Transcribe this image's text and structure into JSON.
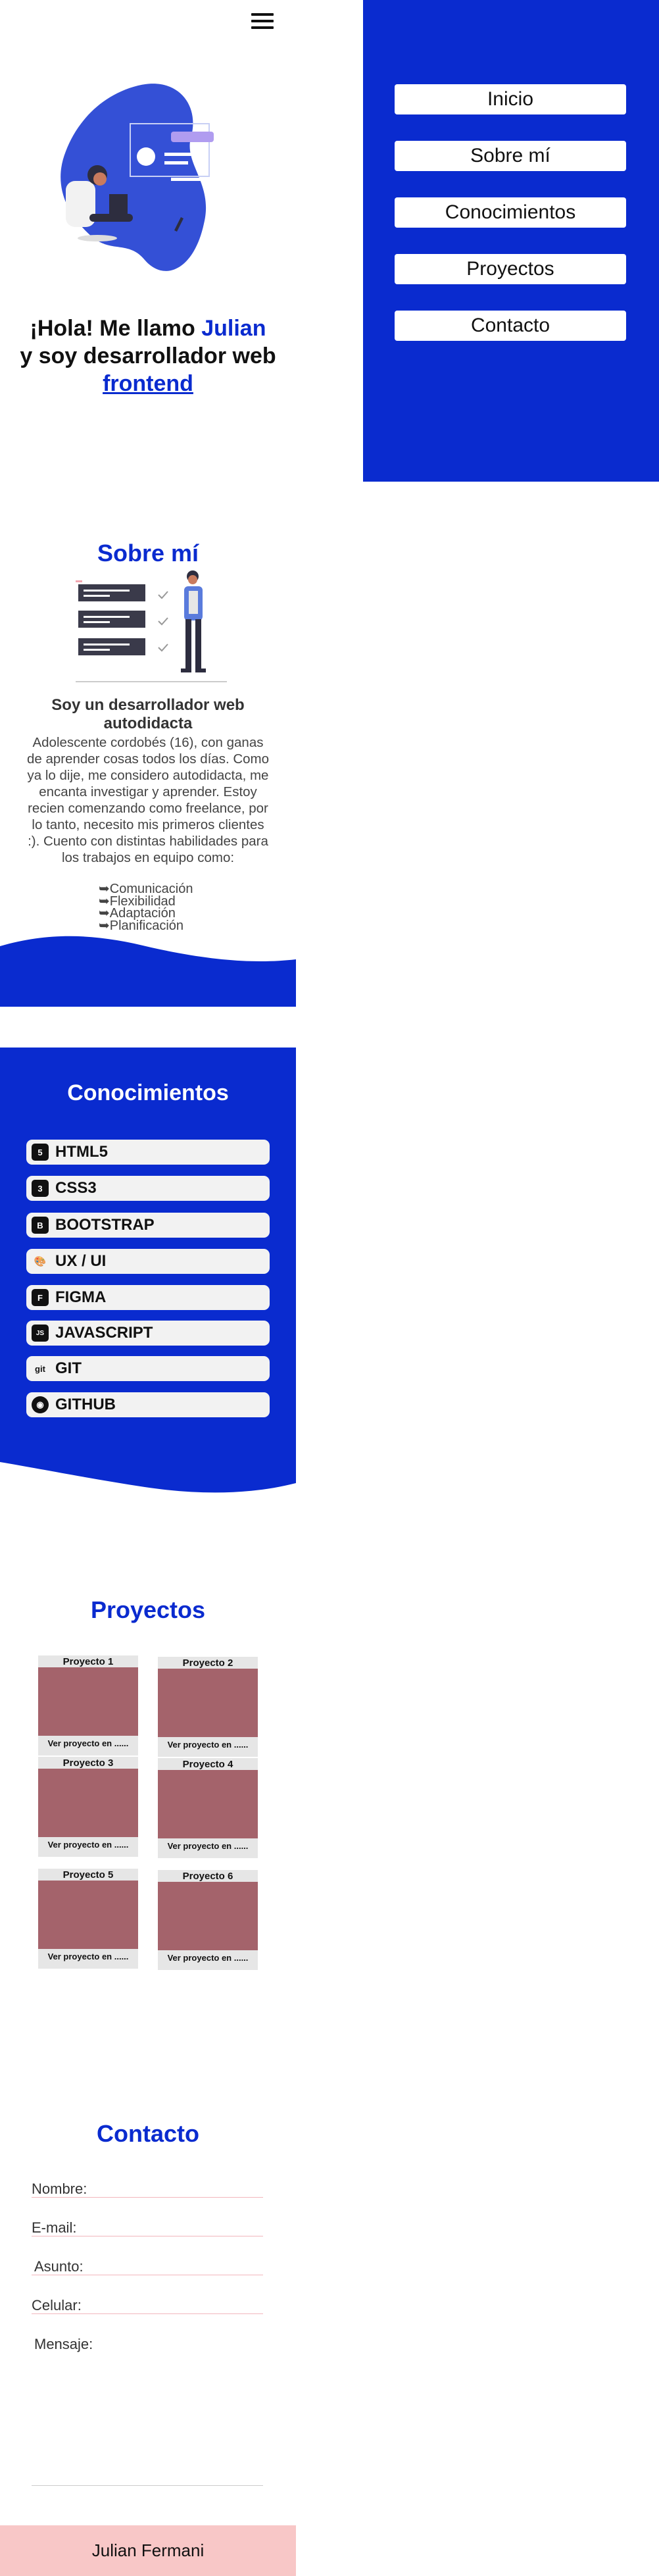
{
  "menu": {
    "items": [
      "Inicio",
      "Sobre mí",
      "Conocimientos",
      "Proyectos",
      "Contacto"
    ]
  },
  "hero": {
    "line1_prefix": "¡Hola! Me llamo ",
    "name": "Julian",
    "line2": "y soy desarrollador web",
    "role": "frontend"
  },
  "about": {
    "title": "Sobre mí",
    "subtitle": "Soy un desarrollador web autodidacta",
    "text": "Adolescente cordobés (16), con ganas de aprender cosas todos los días. Como ya lo dije, me considero autodidacta, me encanta investigar y aprender. Estoy recien comenzando como freelance, por lo tanto, necesito mis primeros clientes :). Cuento con distintas habilidades para los trabajos en equipo como:",
    "skills": [
      "➥Comunicación",
      "➥Flexibilidad",
      "➥Adaptación",
      "➥Planificación"
    ]
  },
  "knowledge": {
    "title": "Conocimientos",
    "items": [
      {
        "label": "HTML5",
        "icon": "html5-icon",
        "glyph": "5"
      },
      {
        "label": "CSS3",
        "icon": "css3-icon",
        "glyph": "3"
      },
      {
        "label": "BOOTSTRAP",
        "icon": "bootstrap-icon",
        "glyph": "B"
      },
      {
        "label": "UX / UI",
        "icon": "palette-icon",
        "glyph": "🎨"
      },
      {
        "label": "FIGMA",
        "icon": "figma-icon",
        "glyph": "F"
      },
      {
        "label": "JAVASCRIPT",
        "icon": "javascript-icon",
        "glyph": "JS"
      },
      {
        "label": "GIT",
        "icon": "git-icon",
        "glyph": "git"
      },
      {
        "label": "GITHUB",
        "icon": "github-icon",
        "glyph": "◉"
      }
    ]
  },
  "projects": {
    "title": "Proyectos",
    "items": [
      {
        "name": "Proyecto 1",
        "link": "Ver proyecto en ......"
      },
      {
        "name": "Proyecto 2",
        "link": "Ver proyecto en ......"
      },
      {
        "name": "Proyecto 3",
        "link": "Ver proyecto en ......"
      },
      {
        "name": "Proyecto 4",
        "link": "Ver proyecto en ......"
      },
      {
        "name": "Proyecto 5",
        "link": "Ver proyecto en ......"
      },
      {
        "name": "Proyecto 6",
        "link": "Ver proyecto en ......"
      }
    ]
  },
  "contact": {
    "title": "Contacto",
    "fields": [
      "Nombre:",
      "E-mail:",
      "Asunto:",
      "Celular:"
    ],
    "message_label": "Mensaje:"
  },
  "footer": {
    "text": "Julian Fermani"
  },
  "colors": {
    "primary": "#0a2bcf",
    "footer": "#f8c7c7",
    "project_image": "#a4636b"
  }
}
